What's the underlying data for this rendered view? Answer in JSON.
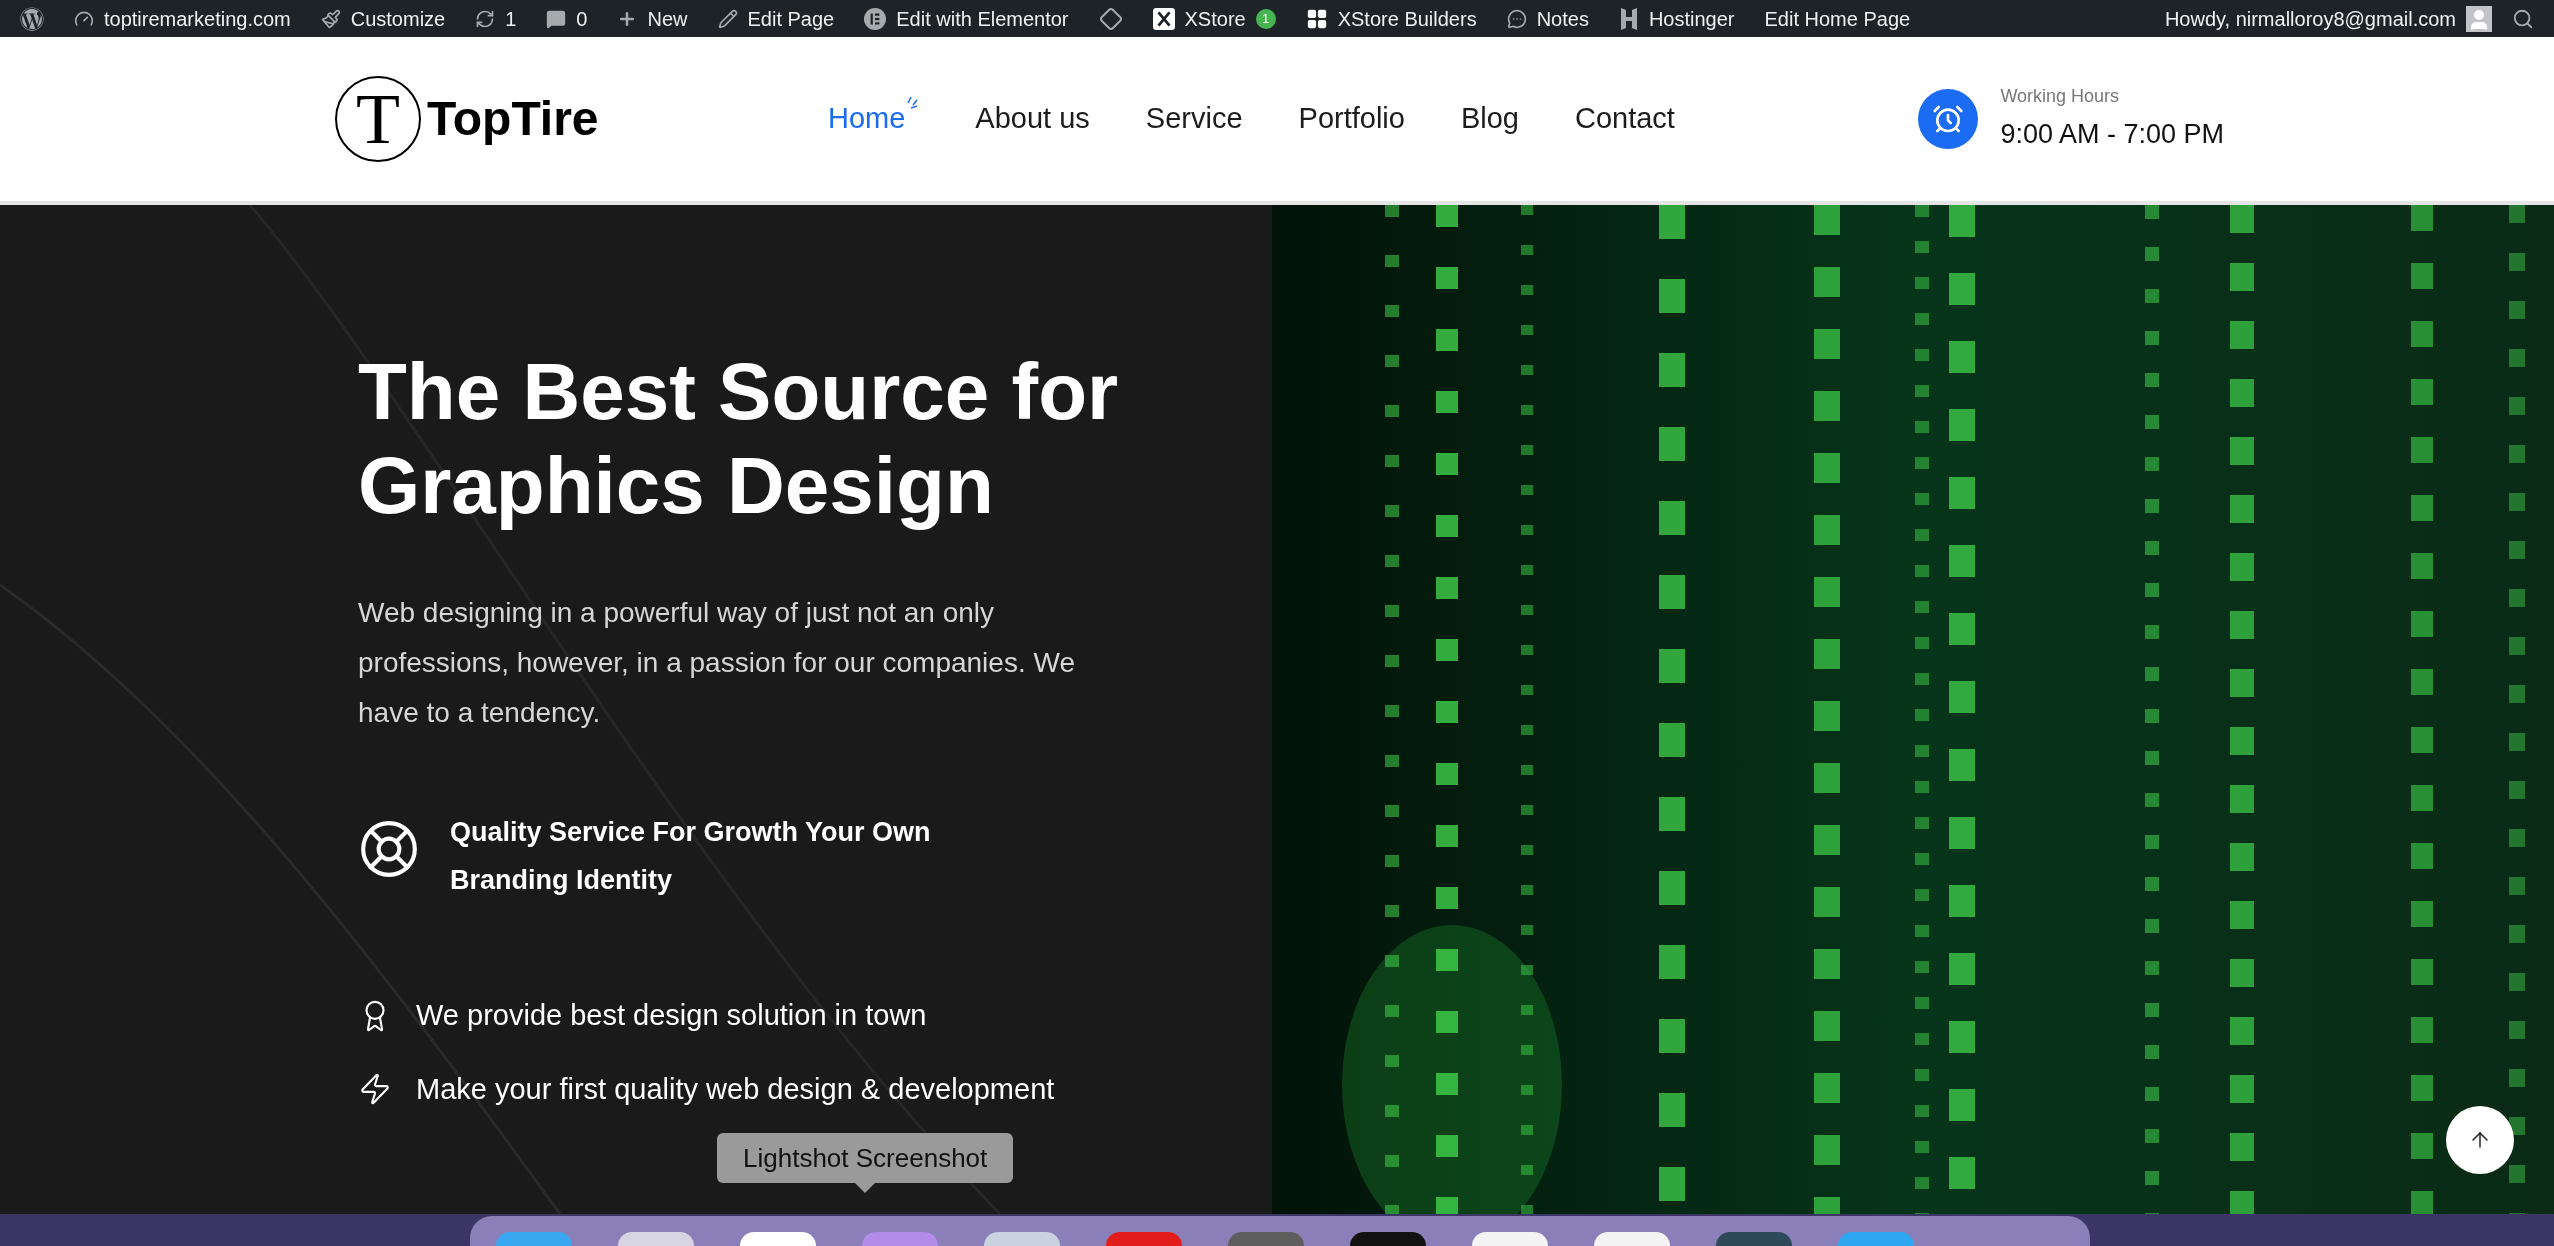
{
  "admin_bar": {
    "items": [
      {
        "kind": "wordpress"
      },
      {
        "kind": "site",
        "label": "toptiremarketing.com"
      },
      {
        "kind": "customize",
        "label": "Customize"
      },
      {
        "kind": "updates",
        "label": "1"
      },
      {
        "kind": "comments",
        "label": "0"
      },
      {
        "kind": "new",
        "label": "New"
      },
      {
        "kind": "edit",
        "label": "Edit Page"
      },
      {
        "kind": "elementor",
        "label": "Edit with Elementor"
      },
      {
        "kind": "theme"
      },
      {
        "kind": "xstore",
        "label": "XStore",
        "badge": "1"
      },
      {
        "kind": "builders",
        "label": "XStore Builders"
      },
      {
        "kind": "notes",
        "label": "Notes"
      },
      {
        "kind": "hostinger",
        "label": "Hostinger"
      },
      {
        "kind": "text",
        "label": "Edit Home Page"
      }
    ],
    "account": "Howdy, nirmalloroy8@gmail.com"
  },
  "header": {
    "logo": {
      "letter": "T",
      "name": "TopTire"
    },
    "nav": [
      {
        "label": "Home",
        "selected": true
      },
      {
        "label": "About us",
        "selected": false
      },
      {
        "label": "Service",
        "selected": false
      },
      {
        "label": "Portfolio",
        "selected": false
      },
      {
        "label": "Blog",
        "selected": false
      },
      {
        "label": "Contact",
        "selected": false
      }
    ],
    "working_hours": {
      "label": "Working Hours",
      "value": "9:00 AM - 7:00 PM"
    }
  },
  "hero": {
    "title_lines": [
      "The Best Source for",
      "Graphics Design"
    ],
    "description": "Web designing in a powerful way of just not an only professions, however, in a passion for our companies. We have to a tendency.",
    "feature": "Quality Service For Growth Your Own Branding Identity",
    "bullets": [
      {
        "kind": "award",
        "text": "We provide best design solution in town"
      },
      {
        "kind": "bolt",
        "text": "Make your first quality web design & development"
      }
    ]
  },
  "tooltip": "Lightshot Screenshot"
}
